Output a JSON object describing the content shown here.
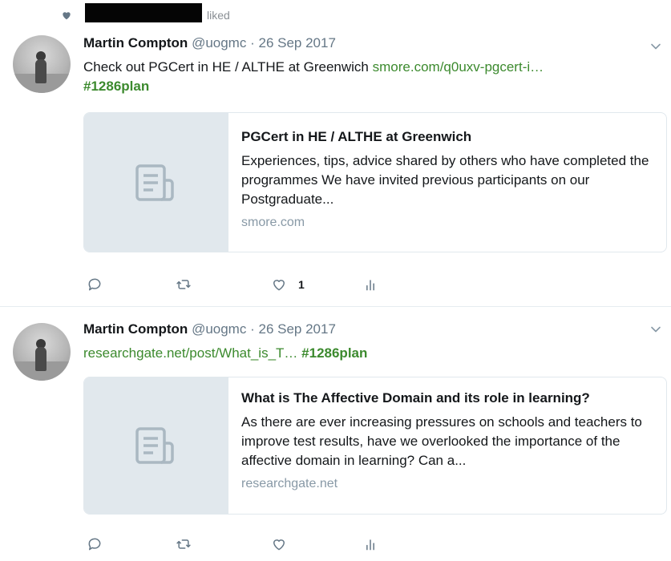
{
  "activity": {
    "liked_text": "liked"
  },
  "tweets": [
    {
      "author": "Martin Compton",
      "handle": "@uogmc",
      "separator": "·",
      "date": "26 Sep 2017",
      "text": "Check out PGCert in HE / ALTHE at Greenwich",
      "link": "smore.com/q0uxv-pgcert-i…",
      "hashtag": "#1286plan",
      "card": {
        "title": "PGCert in HE / ALTHE at Greenwich",
        "description": "Experiences, tips, advice shared by others who have completed the programmes We have invited previous participants on our Postgraduate...",
        "domain": "smore.com"
      },
      "likes": "1"
    },
    {
      "author": "Martin Compton",
      "handle": "@uogmc",
      "separator": "·",
      "date": "26 Sep 2017",
      "link": "researchgate.net/post/What_is_T…",
      "hashtag": "#1286plan",
      "card": {
        "title": "What is The Affective Domain and its role in learning?",
        "description": "As there are ever increasing pressures on schools and teachers to improve test results, have we overlooked the importance of the affective domain in learning? Can a...",
        "domain": "researchgate.net"
      }
    }
  ],
  "icons": [
    "heart-icon",
    "chevron-down-icon",
    "document-icon",
    "reply-icon",
    "retweet-icon",
    "like-icon",
    "analytics-icon"
  ],
  "colors": {
    "link": "#3c8a2e",
    "muted": "#657786",
    "card_thumb": "#e1e8ed",
    "icon": "#657786"
  }
}
